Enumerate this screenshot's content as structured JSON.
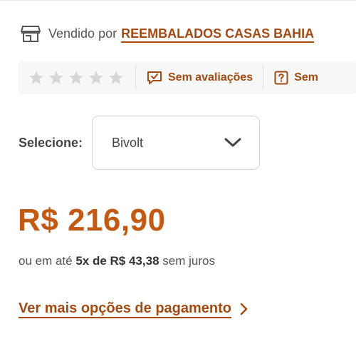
{
  "seller": {
    "label": "Vendido por",
    "name": "REEMBALADOS CASAS BAHIA",
    "icon": "store-icon"
  },
  "rating": {
    "stars_filled": 0,
    "stars_total": 5,
    "reviews_link": "Sem avaliações",
    "questions_link": "Sem"
  },
  "selector": {
    "label": "Selecione:",
    "value": "Bivolt"
  },
  "price": {
    "amount": "R$ 216,90",
    "installments_prefix": "ou em até ",
    "installments_count": "5x de R$ 43,38",
    "installments_suffix": " sem juros"
  },
  "payment": {
    "more_options": "Ver mais opções de pagamento"
  },
  "colors": {
    "accent": "#a34a12",
    "price": "#c35a14",
    "star_empty": "#d6d6d6"
  }
}
